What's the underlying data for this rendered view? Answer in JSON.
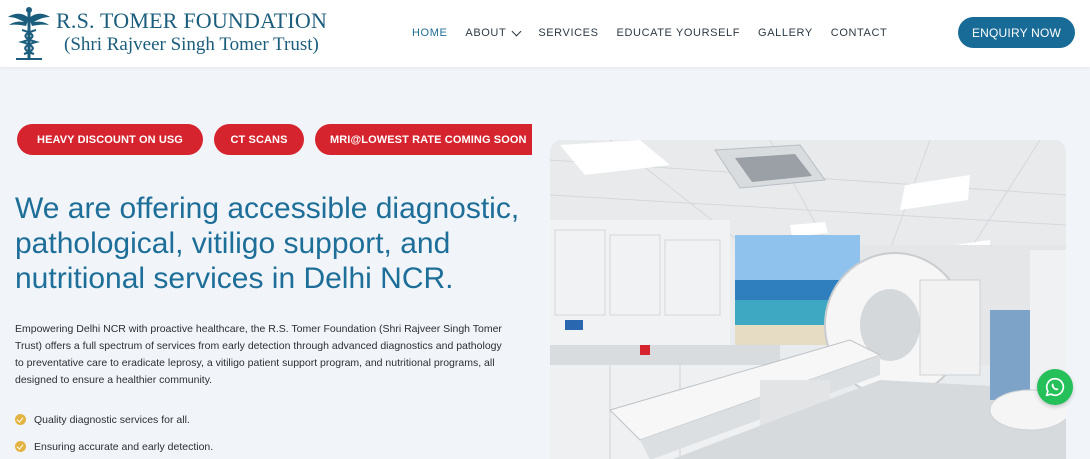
{
  "brand": {
    "title": "R.S. TOMER FOUNDATION",
    "subtitle": "(Shri Rajveer Singh Tomer Trust)",
    "logo_icon": "caduceus-icon"
  },
  "nav": {
    "items": [
      {
        "label": "HOME",
        "active": true
      },
      {
        "label": "ABOUT",
        "has_dropdown": true
      },
      {
        "label": "SERVICES"
      },
      {
        "label": "EDUCATE YOURSELF"
      },
      {
        "label": "GALLERY"
      },
      {
        "label": "CONTACT"
      }
    ],
    "cta": "ENQUIRY NOW"
  },
  "hero": {
    "pills": [
      "HEAVY DISCOUNT ON USG",
      "CT SCANS",
      "MRI@LOWEST RATE COMING SOON"
    ],
    "headline": "We are offering accessible diagnostic, pathological, vitiligo support, and nutritional services in Delhi NCR.",
    "description": "Empowering Delhi NCR with proactive healthcare, the R.S. Tomer Foundation (Shri Rajveer Singh Tomer Trust) offers a full spectrum of services from early detection through advanced diagnostics and pathology to preventative care to eradicate leprosy, a vitiligo patient support program, and nutritional programs, all designed to ensure a healthier community.",
    "bullets": [
      "Quality diagnostic services for all.",
      "Ensuring accurate and early detection."
    ],
    "image_icon": "ct-scanner-room-photo"
  },
  "floating": {
    "whatsapp_icon": "whatsapp-icon"
  },
  "colors": {
    "brand_blue": "#1b5d7d",
    "accent_blue": "#186b97",
    "pill_red": "#d6242e",
    "bullet_gold": "#e3b341",
    "whatsapp_green": "#25c05a"
  }
}
